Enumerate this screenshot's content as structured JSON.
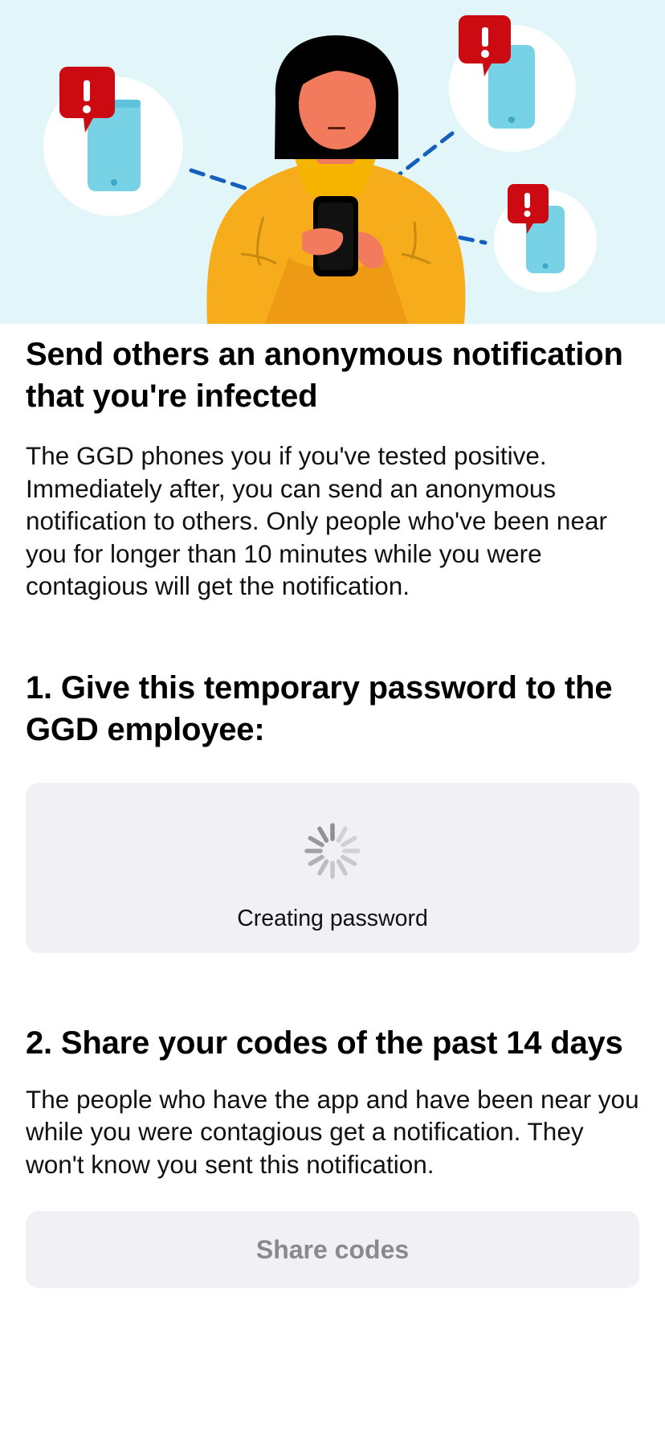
{
  "hero": {
    "illustration": "person-with-phone-sending-notifications"
  },
  "intro": {
    "title": "Send others an anonymous notification that you're infected",
    "body": "The GGD phones you if you've tested positive. Immediately after, you can send an anonymous notification to others. Only people who've been near you for longer than 10 minutes while you were contagious will get the notification."
  },
  "step1": {
    "heading": "1. Give this temporary password to the GGD employee:",
    "status": "Creating password",
    "spinner_icon": "loading-spinner-icon"
  },
  "step2": {
    "heading": "2. Share your codes of the past 14 days",
    "body": "The people who have the app and have been near you while you were contagious get a notification. They won't know you sent this notification.",
    "button_label": "Share codes",
    "button_state": "disabled"
  },
  "colors": {
    "hero_background": "#e2f5f8",
    "card_background": "#f0f0f5",
    "disabled_text": "#8a8a8e",
    "alert_red": "#cc0a12",
    "phone_blue": "#78d2e6",
    "jacket_yellow": "#f7ac1b",
    "line_blue": "#1560bd"
  }
}
